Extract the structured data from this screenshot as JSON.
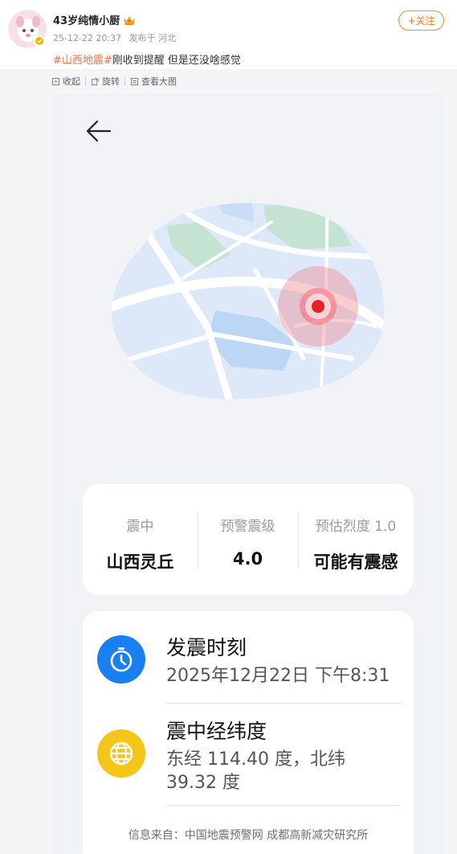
{
  "post": {
    "username": "43岁纯情小厨",
    "date": "25-12-22 20:37",
    "location": "发布于 河北",
    "follow_label": "+关注",
    "hashtag": "#山西地震#",
    "text": "刚收到提醒 但是还没啥感觉"
  },
  "toolbar": {
    "collapse_label": "收起",
    "rotate_label": "旋转",
    "view_large_label": "查看大图"
  },
  "alert": {
    "epicenter_label": "震中",
    "epicenter_value": "山西灵丘",
    "magnitude_label": "预警震级",
    "magnitude_value": "4.0",
    "intensity_label": "预估烈度 1.0",
    "intensity_value": "可能有震感",
    "time_title": "发震时刻",
    "time_value": "2025年12月22日 下午8:31",
    "coords_title": "震中经纬度",
    "coords_value_line1": "东经 114.40 度，北纬",
    "coords_value_line2": "39.32 度",
    "source": "信息来自：中国地震预警网 成都高新减灾研究所"
  },
  "colors": {
    "accent": "#eb7350",
    "clock_icon_bg": "#1a7ff0",
    "globe_icon_bg": "#f5c518",
    "epicenter_marker": "#e8202a"
  },
  "icons": [
    "back-arrow-icon",
    "map-illustration",
    "epicenter-marker-icon",
    "clock-icon",
    "globe-icon",
    "crown-icon",
    "verified-icon",
    "collapse-icon",
    "rotate-icon",
    "view-large-icon"
  ]
}
